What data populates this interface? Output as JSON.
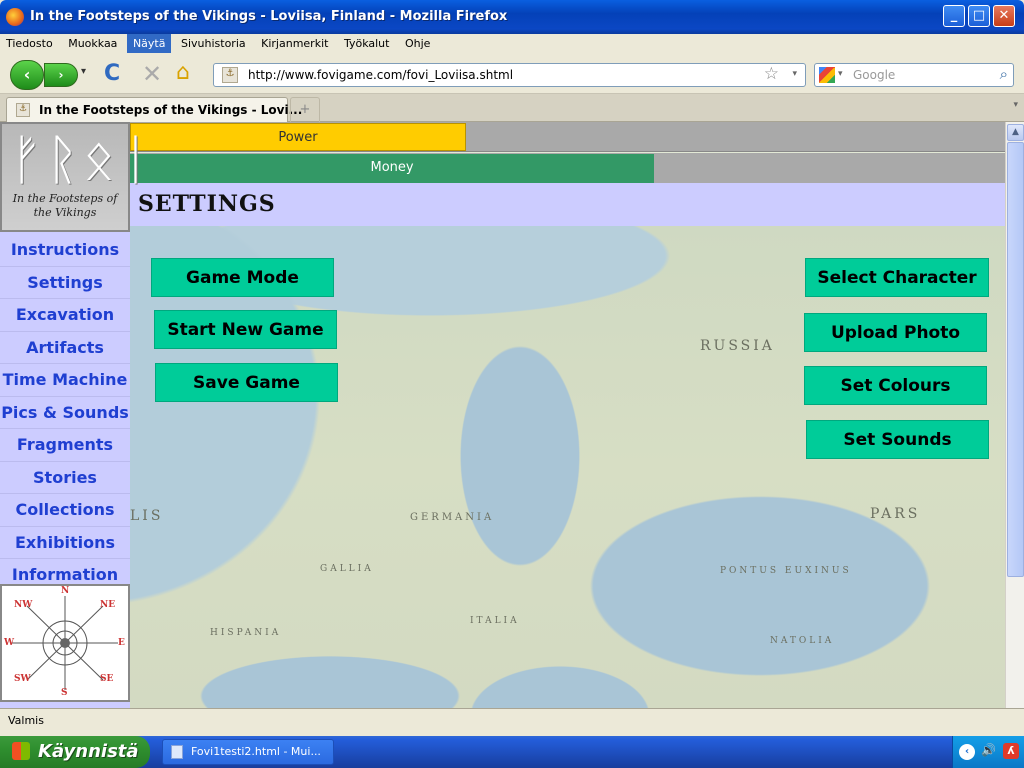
{
  "window": {
    "title": "In the Footsteps of the Vikings - Loviisa, Finland - Mozilla Firefox",
    "controls": {
      "minimize": "_",
      "maximize": "□",
      "close": "✕"
    }
  },
  "menu": [
    "Tiedosto",
    "Muokkaa",
    "Näytä",
    "Sivuhistoria",
    "Kirjanmerkit",
    "Työkalut",
    "Ohje"
  ],
  "menu_active": "Näytä",
  "nav": {
    "url": "http://www.fovigame.com/fovi_Loviisa.shtml",
    "search_placeholder": "Google",
    "back_icon": "‹",
    "forward_icon": "›",
    "dropdown_icon": "▾",
    "reload_icon": "C",
    "stop_icon": "✕",
    "home_icon": "⌂",
    "star_icon": "☆",
    "search_go_icon": "⌕"
  },
  "tab": {
    "label": "In the Footsteps of the Vikings - Lovi...",
    "new_tab": "+",
    "list_icon": "▾"
  },
  "page": {
    "logo_text": "In the Footsteps of the Vikings",
    "power_label": "Power",
    "power_level": 0.384,
    "money_label": "Money",
    "money_level": 0.599,
    "section_title": "SETTINGS",
    "sidebar": [
      "Instructions",
      "Settings",
      "Excavation",
      "Artifacts",
      "Time Machine",
      "Pics & Sounds",
      "Fragments",
      "Stories",
      "Collections",
      "Exhibitions",
      "Information"
    ],
    "left_buttons": [
      "Game Mode",
      "Start New Game",
      "Save Game"
    ],
    "right_buttons": [
      "Select Character",
      "Upload Photo",
      "Set Colours",
      "Set Sounds"
    ],
    "compass": [
      "N",
      "NE",
      "E",
      "SE",
      "S",
      "SW",
      "W",
      "NW"
    ],
    "colors": {
      "sidebar_bg": "#ccccff",
      "sidebar_text": "#1f3fd1",
      "power": "#ffcc00",
      "money": "#339966",
      "button": "#00cc99"
    }
  },
  "status": "Valmis",
  "taskbar": {
    "start": "Käynnistä",
    "task": "Fovi1testi2.html - Mui..."
  }
}
